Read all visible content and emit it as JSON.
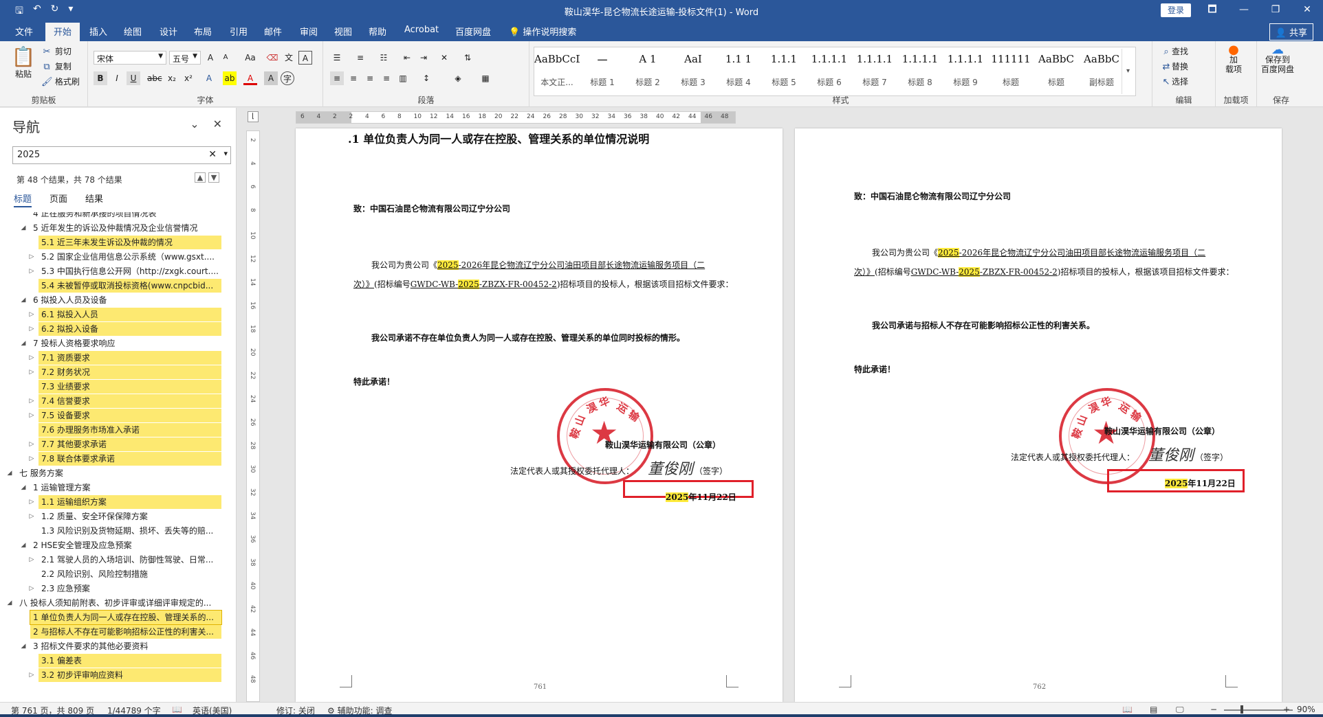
{
  "window": {
    "title": "鞍山淏华-昆仑物流长途运输-投标文件(1)  -  Word",
    "login": "登录",
    "qat": [
      "🖫",
      "↶",
      "↻",
      "▾"
    ],
    "controls": [
      "🗖",
      "—",
      "❐",
      "✕"
    ]
  },
  "tabs": {
    "items": [
      "文件",
      "开始",
      "插入",
      "绘图",
      "设计",
      "布局",
      "引用",
      "邮件",
      "审阅",
      "视图",
      "帮助",
      "Acrobat",
      "百度网盘"
    ],
    "tellme": "操作说明搜索",
    "share": "共享"
  },
  "ribbon": {
    "clipboard": {
      "paste": "粘贴",
      "cut": "剪切",
      "copy": "复制",
      "painter": "格式刷",
      "label": "剪贴板"
    },
    "font": {
      "name": "宋体",
      "size": "五号",
      "label": "字体"
    },
    "paragraph": {
      "label": "段落"
    },
    "styles": {
      "label": "样式",
      "items": [
        {
          "preview": "AaBbCcDdI",
          "name": "本文正..."
        },
        {
          "preview": "一",
          "name": "标题 1"
        },
        {
          "preview": "A 1",
          "name": "标题 2"
        },
        {
          "preview": "AaI",
          "name": "标题 3"
        },
        {
          "preview": "1.1 1",
          "name": "标题 4"
        },
        {
          "preview": "1.1.1",
          "name": "标题 5"
        },
        {
          "preview": "1.1.1.1",
          "name": "标题 6"
        },
        {
          "preview": "1.1.1.1",
          "name": "标题 7"
        },
        {
          "preview": "1.1.1.1",
          "name": "标题 8"
        },
        {
          "preview": "1.1.1.1",
          "name": "标题 9"
        },
        {
          "preview": "111111",
          "name": "标题"
        },
        {
          "preview": "AaBbC",
          "name": "标题"
        },
        {
          "preview": "AaBbC",
          "name": "副标题"
        }
      ]
    },
    "editing": {
      "find": "查找",
      "replace": "替换",
      "select": "选择",
      "label": "编辑"
    },
    "addins": {
      "btn": "加\n载项",
      "label": "加载项"
    },
    "save": {
      "btn": "保存到\n百度网盘",
      "label": "保存"
    }
  },
  "nav": {
    "title": "导航",
    "search_value": "2025",
    "count": "第 48 个结果，共 78 个结果",
    "tabs": [
      "标题",
      "页面",
      "结果"
    ],
    "items": [
      {
        "text": "4 正在服务和新承接的项目情况表",
        "level": 2,
        "tri": "",
        "hl": false
      },
      {
        "text": "5 近年发生的诉讼及仲裁情况及企业信誉情况",
        "level": 2,
        "tri": "◢",
        "hl": false
      },
      {
        "text": "5.1 近三年未发生诉讼及仲裁的情况",
        "level": 3,
        "tri": "",
        "hl": true
      },
      {
        "text": "5.2 国家企业信用信息公示系统（www.gsxt....",
        "level": 3,
        "tri": "▷",
        "hl": false
      },
      {
        "text": "5.3 中国执行信息公开网（http://zxgk.court....",
        "level": 3,
        "tri": "▷",
        "hl": false
      },
      {
        "text": "5.4 未被暂停或取消投标资格(www.cnpcbid...",
        "level": 3,
        "tri": "",
        "hl": true
      },
      {
        "text": "6 拟投入人员及设备",
        "level": 2,
        "tri": "◢",
        "hl": false
      },
      {
        "text": "6.1 拟投入人员",
        "level": 3,
        "tri": "▷",
        "hl": true
      },
      {
        "text": "6.2 拟投入设备",
        "level": 3,
        "tri": "▷",
        "hl": true
      },
      {
        "text": "7 投标人资格要求响应",
        "level": 2,
        "tri": "◢",
        "hl": false
      },
      {
        "text": "7.1 资质要求",
        "level": 3,
        "tri": "▷",
        "hl": true
      },
      {
        "text": "7.2 财务状况",
        "level": 3,
        "tri": "▷",
        "hl": true
      },
      {
        "text": "7.3 业绩要求",
        "level": 3,
        "tri": "",
        "hl": true
      },
      {
        "text": "7.4 信誉要求",
        "level": 3,
        "tri": "▷",
        "hl": true
      },
      {
        "text": "7.5 设备要求",
        "level": 3,
        "tri": "▷",
        "hl": true
      },
      {
        "text": "7.6 办理服务市场准入承诺",
        "level": 3,
        "tri": "",
        "hl": true
      },
      {
        "text": "7.7 其他要求承诺",
        "level": 3,
        "tri": "▷",
        "hl": true
      },
      {
        "text": "7.8 联合体要求承诺",
        "level": 3,
        "tri": "▷",
        "hl": true
      },
      {
        "text": "七 服务方案",
        "level": 1,
        "tri": "◢",
        "hl": false
      },
      {
        "text": "1 运输管理方案",
        "level": 2,
        "tri": "◢",
        "hl": false
      },
      {
        "text": "1.1 运输组织方案",
        "level": 3,
        "tri": "▷",
        "hl": true
      },
      {
        "text": "1.2 质量、安全环保保障方案",
        "level": 3,
        "tri": "▷",
        "hl": false
      },
      {
        "text": "1.3 风险识别及货物延期、损坏、丢失等的赔...",
        "level": 3,
        "tri": "",
        "hl": false
      },
      {
        "text": "2 HSE安全管理及应急预案",
        "level": 2,
        "tri": "◢",
        "hl": false
      },
      {
        "text": "2.1 驾驶人员的入场培训、防御性驾驶、日常...",
        "level": 3,
        "tri": "▷",
        "hl": false
      },
      {
        "text": "2.2 风险识别、风险控制措施",
        "level": 3,
        "tri": "",
        "hl": false
      },
      {
        "text": "2.3 应急预案",
        "level": 3,
        "tri": "▷",
        "hl": false
      },
      {
        "text": "八 投标人须知前附表、初步评审或详细评审规定的...",
        "level": 1,
        "tri": "◢",
        "hl": false
      },
      {
        "text": "1 单位负责人为同一人或存在控股、管理关系的...",
        "level": 2,
        "tri": "",
        "hl": true,
        "sel": true
      },
      {
        "text": "2 与招标人不存在可能影响招标公正性的利害关...",
        "level": 2,
        "tri": "",
        "hl": true
      },
      {
        "text": "3 招标文件要求的其他必要资料",
        "level": 2,
        "tri": "◢",
        "hl": false
      },
      {
        "text": "3.1 偏差表",
        "level": 3,
        "tri": "",
        "hl": true
      },
      {
        "text": "3.2 初步评审响应资料",
        "level": 3,
        "tri": "▷",
        "hl": true
      }
    ]
  },
  "page1": {
    "heading": ".1 单位负责人为同一人或存在控股、管理关系的单位情况说明",
    "to": "致：中国石油昆仑物流有限公司辽宁分公司",
    "para_pre": "我公司为贵公司《",
    "para_hl": "2025",
    "para_mid": "-2026年昆仑物流辽宁分公司油田项目部长途物流运输服务项目（二",
    "para_l2a": "次）》",
    "para_l2b": "(招标编号",
    "para_code_a": "GWDC-WB-",
    "para_code_b": "2025",
    "para_code_c": "-ZBZX-FR-00452-2",
    "para_l2c": ")招标项目的投标人，根据该项目招标文件要求：",
    "promise": "我公司承诺不存在单位负责人为同一人或存在控股、管理关系的单位同时投标的情形。",
    "special": "特此承诺！",
    "company": "鞍山淏华运输有限公司（公章）",
    "rep": "法定代表人或其授权委托代理人：",
    "sign_tag": "（签字）",
    "date_hl": "2025",
    "date_rest": "年11月22日",
    "page_no": "761"
  },
  "page2": {
    "to": "致：中国石油昆仑物流有限公司辽宁分公司",
    "para_pre": "我公司为贵公司《",
    "para_hl": "2025",
    "para_mid": "-2026年昆仑物流辽宁分公司油田项目部长途物流运输服务项目（二",
    "para_l2a": "次）》",
    "para_l2b": "(招标编号",
    "para_code_a": "GWDC-WB-",
    "para_code_b": "2025",
    "para_code_c": "-ZBZX-FR-00452-2",
    "para_l2c": ")招标项目的投标人，根据该项目招标文件要求：",
    "promise": "我公司承诺与招标人不存在可能影响招标公正性的利害关系。",
    "special": "特此承诺！",
    "company": "鞍山淏华运输有限公司（公章）",
    "rep": "法定代表人或其授权委托代理人：",
    "sign_tag": "（签字）",
    "date_hl": "2025",
    "date_rest": "年11月22日",
    "page_no": "762"
  },
  "seal": {
    "text": "鞍山淏华运输有限公司",
    "color": "#d81e2a"
  },
  "signature": "董俊刚",
  "status": {
    "pages": "第 761 页，共 809 页",
    "words": "1/44789 个字",
    "lang": "英语(美国)",
    "track": "修订: 关闭",
    "access": "辅助功能: 调查",
    "zoom": "90%"
  },
  "colors": {
    "accent": "#2b579a",
    "highlight": "#fde971",
    "seal": "#d81e2a",
    "redbox": "#e0202a"
  }
}
